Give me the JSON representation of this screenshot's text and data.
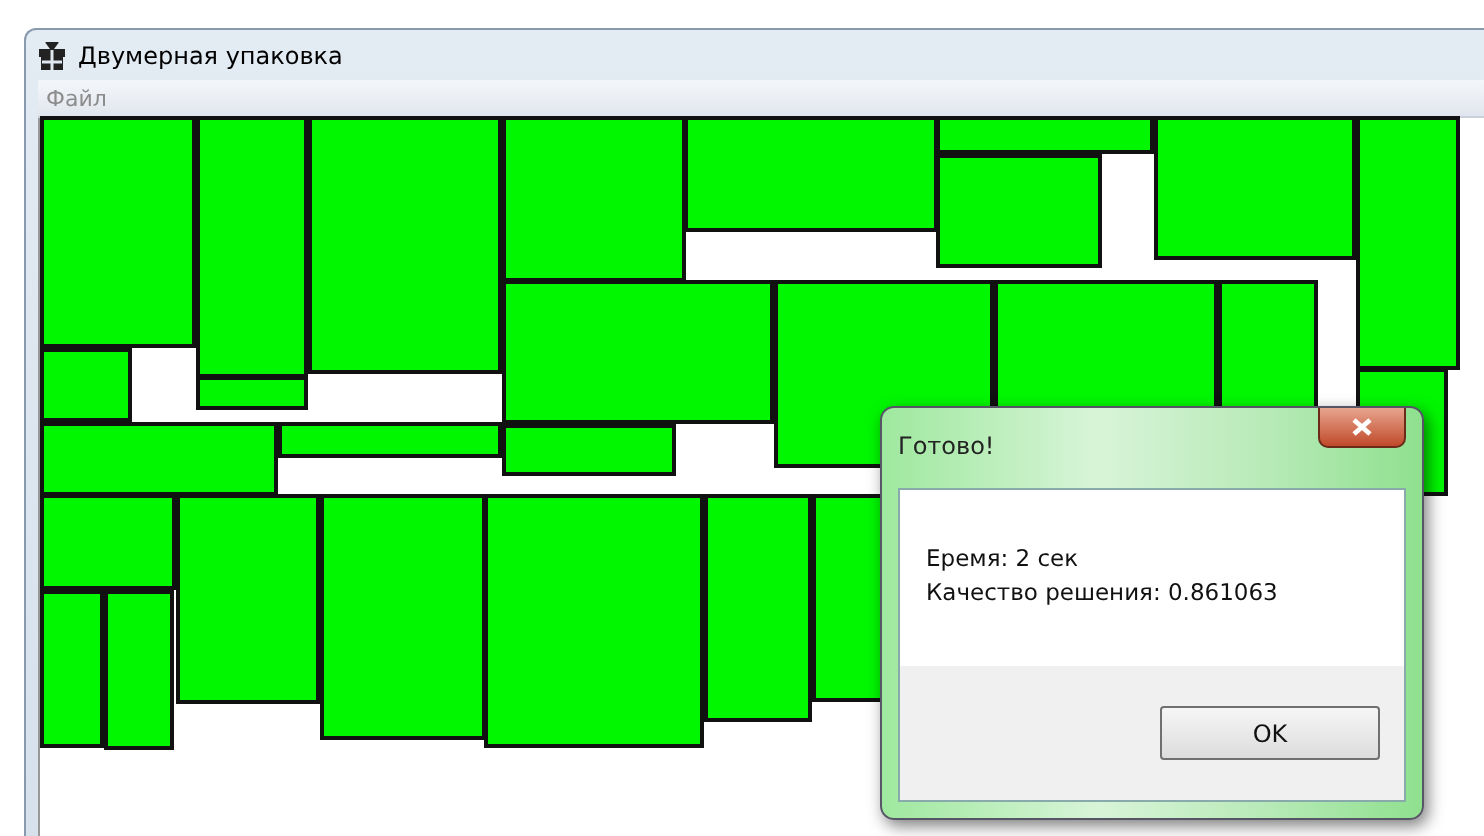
{
  "window": {
    "title": "Двумерная упаковка"
  },
  "menu": [
    "Файл"
  ],
  "dialog": {
    "title": "Готово!",
    "lines": [
      "Еремя: 2 сек",
      "Качество решения: 0.861063"
    ],
    "buttons": [
      "OK"
    ]
  }
}
